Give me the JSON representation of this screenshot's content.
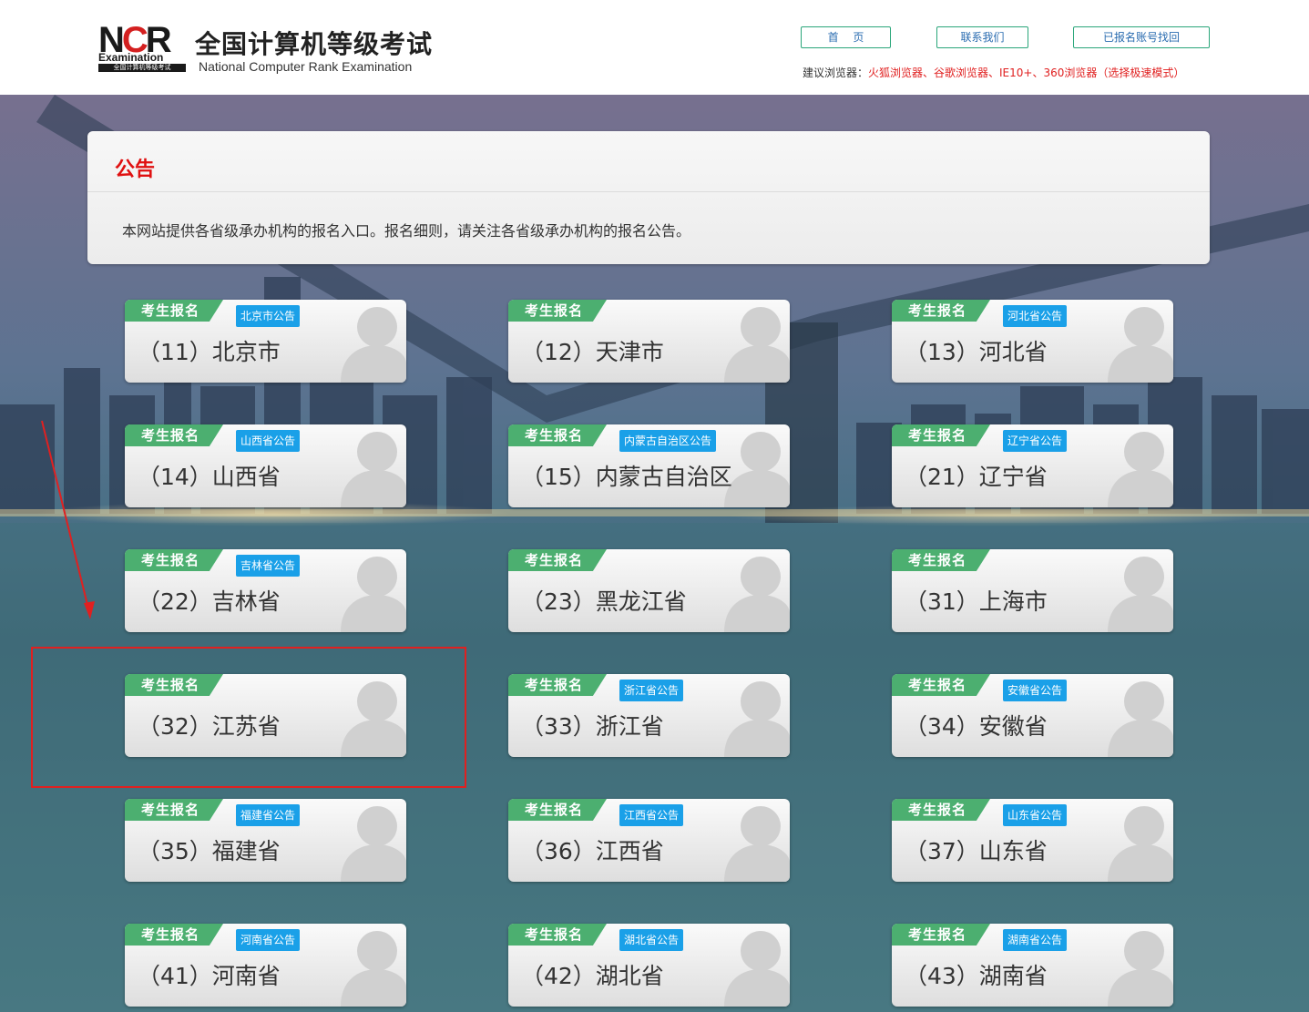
{
  "header": {
    "logo_letters_n": "N",
    "logo_letters_c": "C",
    "logo_letters_r": "R",
    "logo_examination": "Examination",
    "logo_bar_text": "全国计算机等级考试",
    "title": "全国计算机等级考试",
    "subtitle": "National Computer Rank Examination",
    "nav": {
      "home": "首 页",
      "contact": "联系我们",
      "recover": "已报名账号找回"
    },
    "browser_label": "建议浏览器：",
    "browser_list": "火狐浏览器、谷歌浏览器、IE10+、360浏览器（选择极速模式）"
  },
  "notice": {
    "title": "公告",
    "text": "本网站提供各省级承办机构的报名入口。报名细则，请关注各省级承办机构的报名公告。"
  },
  "tag_label": "考生报名",
  "cards": [
    {
      "name": "（11）北京市",
      "announcement": "北京市公告"
    },
    {
      "name": "（12）天津市",
      "announcement": ""
    },
    {
      "name": "（13）河北省",
      "announcement": "河北省公告"
    },
    {
      "name": "（14）山西省",
      "announcement": "山西省公告"
    },
    {
      "name": "（15）内蒙古自治区",
      "announcement": "内蒙古自治区公告"
    },
    {
      "name": "（21）辽宁省",
      "announcement": "辽宁省公告"
    },
    {
      "name": "（22）吉林省",
      "announcement": "吉林省公告"
    },
    {
      "name": "（23）黑龙江省",
      "announcement": ""
    },
    {
      "name": "（31）上海市",
      "announcement": ""
    },
    {
      "name": "（32）江苏省",
      "announcement": ""
    },
    {
      "name": "（33）浙江省",
      "announcement": "浙江省公告"
    },
    {
      "name": "（34）安徽省",
      "announcement": "安徽省公告"
    },
    {
      "name": "（35）福建省",
      "announcement": "福建省公告"
    },
    {
      "name": "（36）江西省",
      "announcement": "江西省公告"
    },
    {
      "name": "（37）山东省",
      "announcement": "山东省公告"
    },
    {
      "name": "（41）河南省",
      "announcement": "河南省公告"
    },
    {
      "name": "（42）湖北省",
      "announcement": "湖北省公告"
    },
    {
      "name": "（43）湖南省",
      "announcement": "湖南省公告"
    }
  ],
  "colors": {
    "tag_green": "#4caf70",
    "announcement_blue": "#1aa0e8",
    "notice_red": "#e01010",
    "highlight_red": "#e02020"
  }
}
